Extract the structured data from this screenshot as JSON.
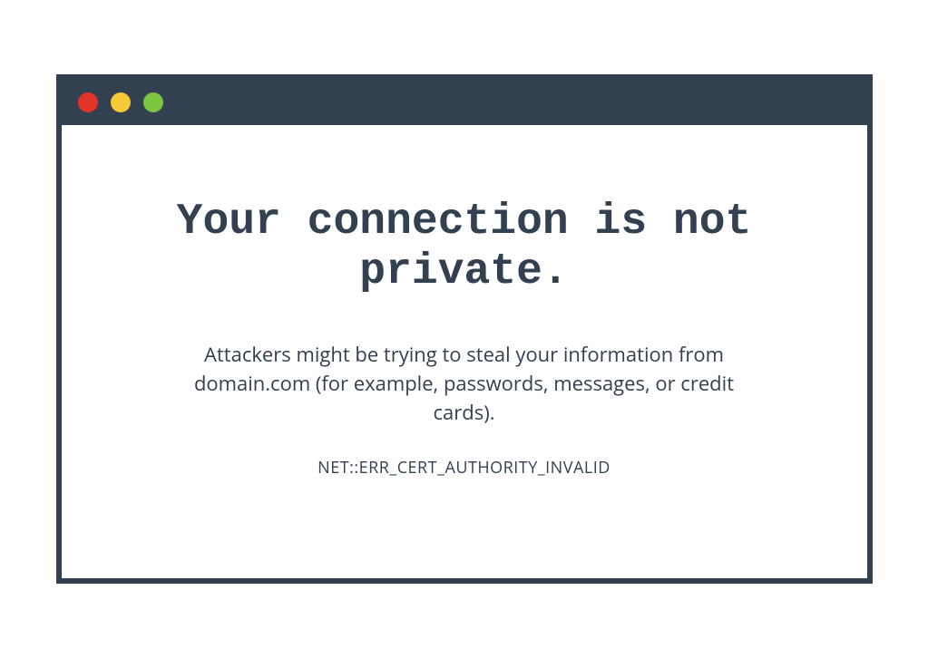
{
  "warning": {
    "heading": "Your connection is not private.",
    "description": "Attackers might be trying to steal your information from domain.com (for example, passwords, messages, or credit cards).",
    "error_code": "NET::ERR_CERT_AUTHORITY_INVALID"
  },
  "colors": {
    "frame": "#334050",
    "red": "#e3342a",
    "yellow": "#f6c939",
    "green": "#7cc540"
  }
}
